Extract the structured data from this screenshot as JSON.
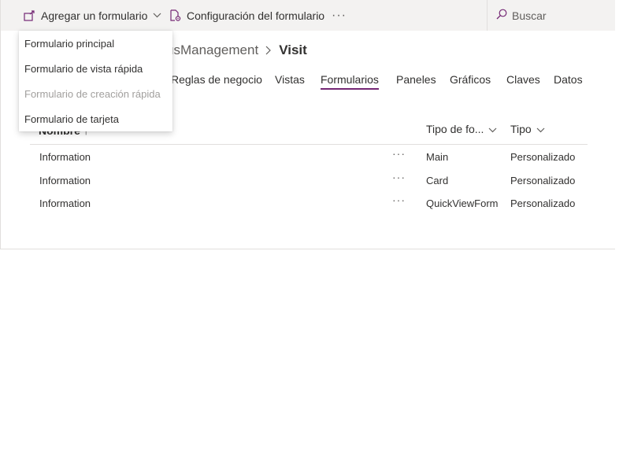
{
  "toolbar": {
    "add_form_label": "Agregar un formulario",
    "form_settings_label": "Configuración del formulario",
    "more_label": "···",
    "search_placeholder": "Buscar"
  },
  "add_form_menu": {
    "items": [
      {
        "label": "Formulario principal",
        "disabled": false
      },
      {
        "label": "Formulario de vista rápida",
        "disabled": false
      },
      {
        "label": "Formulario de creación rápida",
        "disabled": true
      },
      {
        "label": "Formulario de tarjeta",
        "disabled": false
      }
    ]
  },
  "breadcrumb": {
    "parent": "usManagement",
    "current": "Visit"
  },
  "tabs": [
    {
      "label": "Reglas de negocio",
      "active": false
    },
    {
      "label": "Vistas",
      "active": false
    },
    {
      "label": "Formularios",
      "active": true
    },
    {
      "label": "Paneles",
      "active": false
    },
    {
      "label": "Gráficos",
      "active": false
    },
    {
      "label": "Claves",
      "active": false
    },
    {
      "label": "Datos",
      "active": false
    }
  ],
  "grid": {
    "columns": {
      "name": "Nombre ↑",
      "form_type": "Tipo de fo...",
      "type": "Tipo"
    },
    "rows": [
      {
        "name": "Information",
        "more": "···",
        "form_type": "Main",
        "type": "Personalizado"
      },
      {
        "name": "Information",
        "more": "···",
        "form_type": "Card",
        "type": "Personalizado"
      },
      {
        "name": "Information",
        "more": "···",
        "form_type": "QuickViewForm",
        "type": "Personalizado"
      }
    ]
  },
  "colors": {
    "accent": "#742774",
    "command_bar": "#f3f2f1",
    "disabled_text": "#a19f9d"
  }
}
